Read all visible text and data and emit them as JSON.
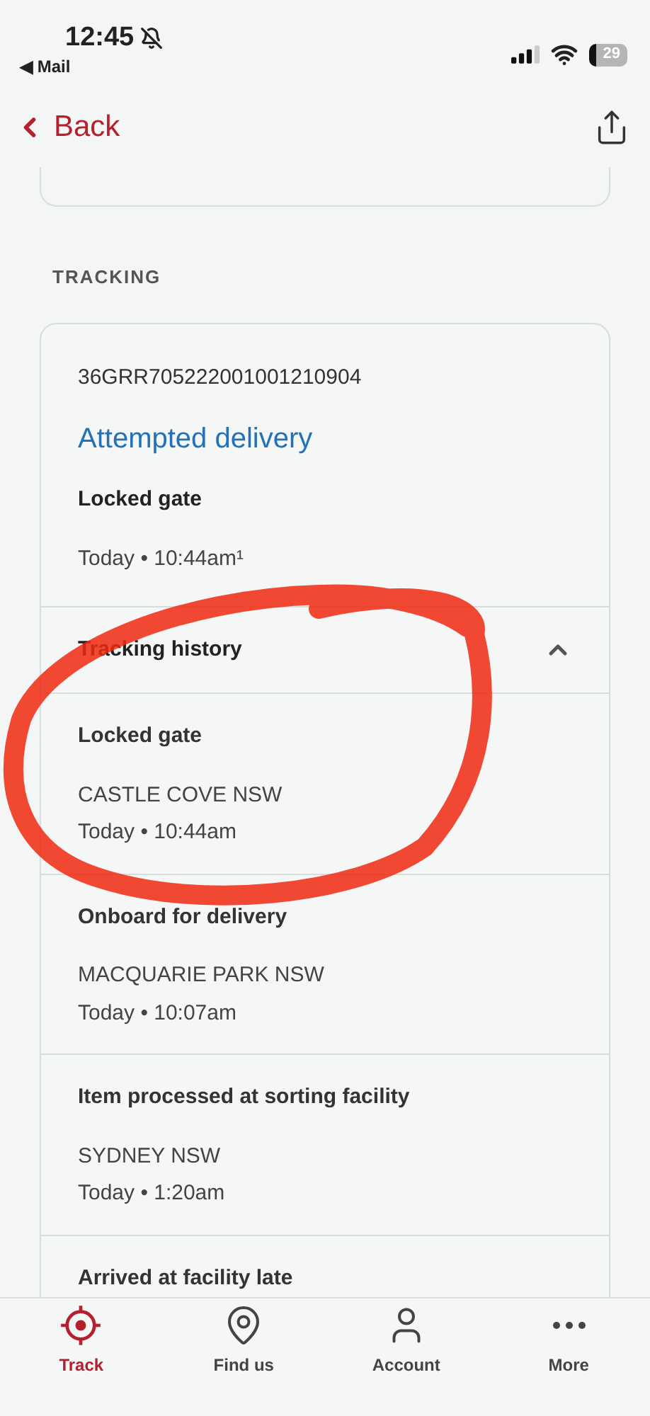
{
  "status_bar": {
    "time": "12:45",
    "back_app": "◀ Mail",
    "battery": "29"
  },
  "nav": {
    "back": "Back"
  },
  "section_label": "TRACKING",
  "tracking": {
    "number": "36GRR705222001001210904",
    "status": "Attempted delivery",
    "reason": "Locked gate",
    "time": "Today • 10:44am¹"
  },
  "history": {
    "title": "Tracking history",
    "expanded": true,
    "events": [
      {
        "title": "Locked gate",
        "location": "CASTLE COVE NSW",
        "time": "Today • 10:44am"
      },
      {
        "title": "Onboard for delivery",
        "location": "MACQUARIE PARK NSW",
        "time": "Today • 10:07am"
      },
      {
        "title": "Item processed at sorting facility",
        "location": "SYDNEY NSW",
        "time": "Today • 1:20am"
      },
      {
        "title": "Arrived at facility late"
      }
    ]
  },
  "tabs": [
    {
      "label": "Track",
      "kind": "track",
      "selected": true
    },
    {
      "label": "Find us",
      "kind": "pin",
      "selected": false
    },
    {
      "label": "Account",
      "kind": "person",
      "selected": false
    },
    {
      "label": "More",
      "kind": "more",
      "selected": false
    }
  ]
}
